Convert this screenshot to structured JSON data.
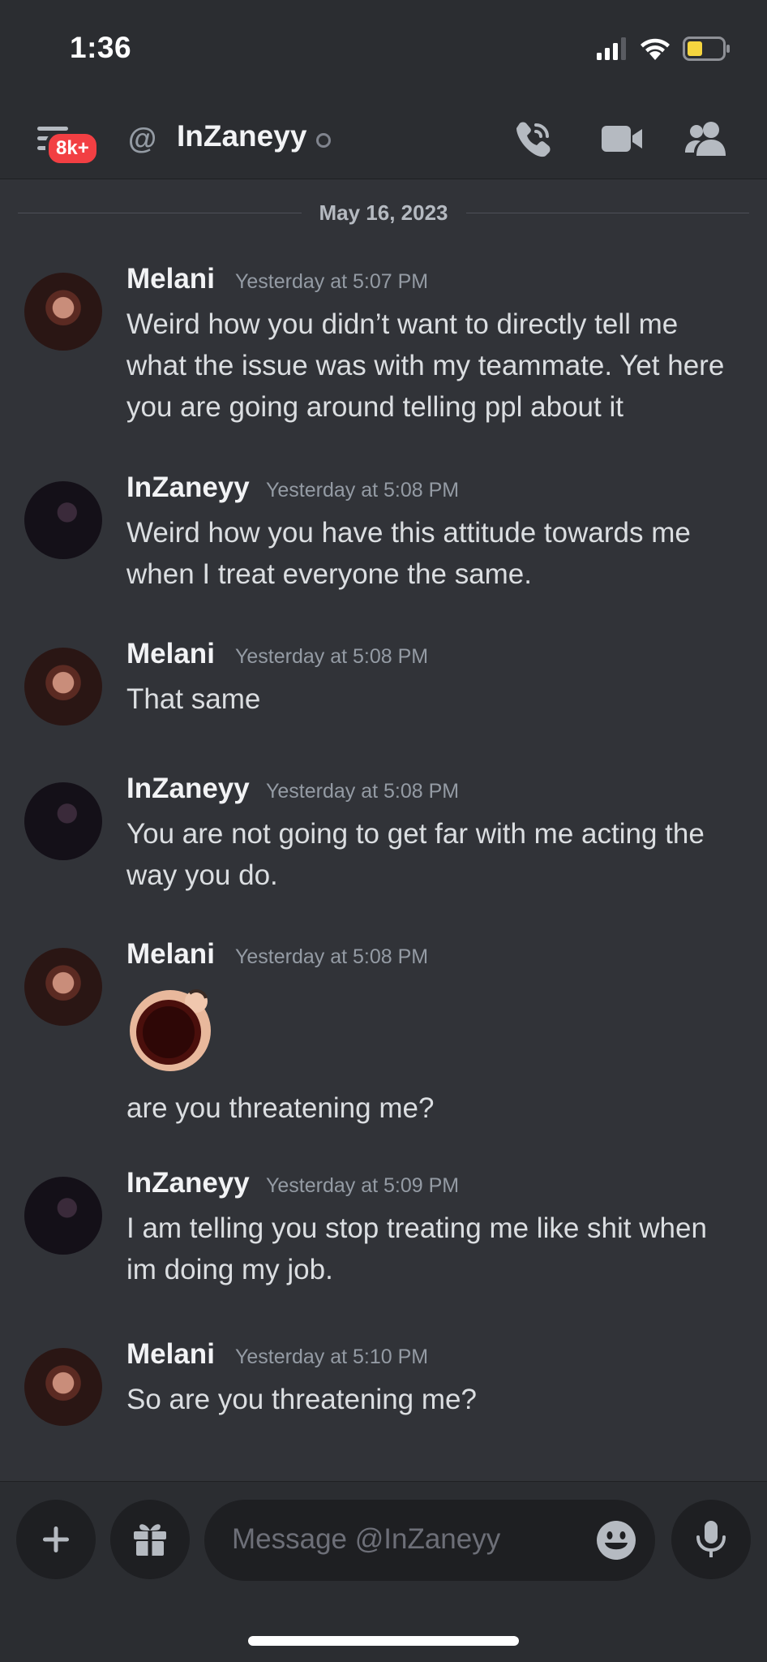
{
  "status_bar": {
    "time": "1:36",
    "icons": [
      "cellular-signal-icon",
      "wifi-icon",
      "battery-icon"
    ]
  },
  "header": {
    "badge": "8k+",
    "at_symbol": "@",
    "title": "InZaneyy",
    "icons": [
      "hamburger-icon",
      "call-icon",
      "video-icon",
      "members-icon"
    ]
  },
  "date_divider": "May 16, 2023",
  "messages": [
    {
      "author": "Melani",
      "timestamp": "Yesterday at 5:07 PM",
      "text": "Weird how you didn’t want to directly tell me what the issue was with my teammate. Yet here you are going around telling ppl about it"
    },
    {
      "author": "InZaneyy",
      "timestamp": "Yesterday at 5:08 PM",
      "text": "Weird how you have this attitude towards me when I treat everyone the same."
    },
    {
      "author": "Melani",
      "timestamp": "Yesterday at 5:08 PM",
      "text": "That same"
    },
    {
      "author": "InZaneyy",
      "timestamp": "Yesterday at 5:08 PM",
      "text": "You are not going to get far with me acting the way you do."
    },
    {
      "author": "Melani",
      "timestamp": "Yesterday at 5:08 PM",
      "emoji": "shocked-face-emoji",
      "text": "are you threatening me?"
    },
    {
      "author": "InZaneyy",
      "timestamp": "Yesterday at 5:09 PM",
      "text": "I am telling you stop treating me like shit when im doing my job."
    },
    {
      "author": "Melani",
      "timestamp": "Yesterday at 5:10 PM",
      "text": "So are you threatening me?"
    }
  ],
  "composer": {
    "placeholder": "Message @InZaneyy",
    "icons": [
      "plus-icon",
      "gift-icon",
      "emoji-icon",
      "microphone-icon"
    ]
  },
  "colors": {
    "background": "#313338",
    "header_bg": "#2b2d31",
    "input_bg": "#1e1f22",
    "badge": "#f23f43",
    "text_primary": "#f2f3f5",
    "text_muted": "#949ba4"
  }
}
